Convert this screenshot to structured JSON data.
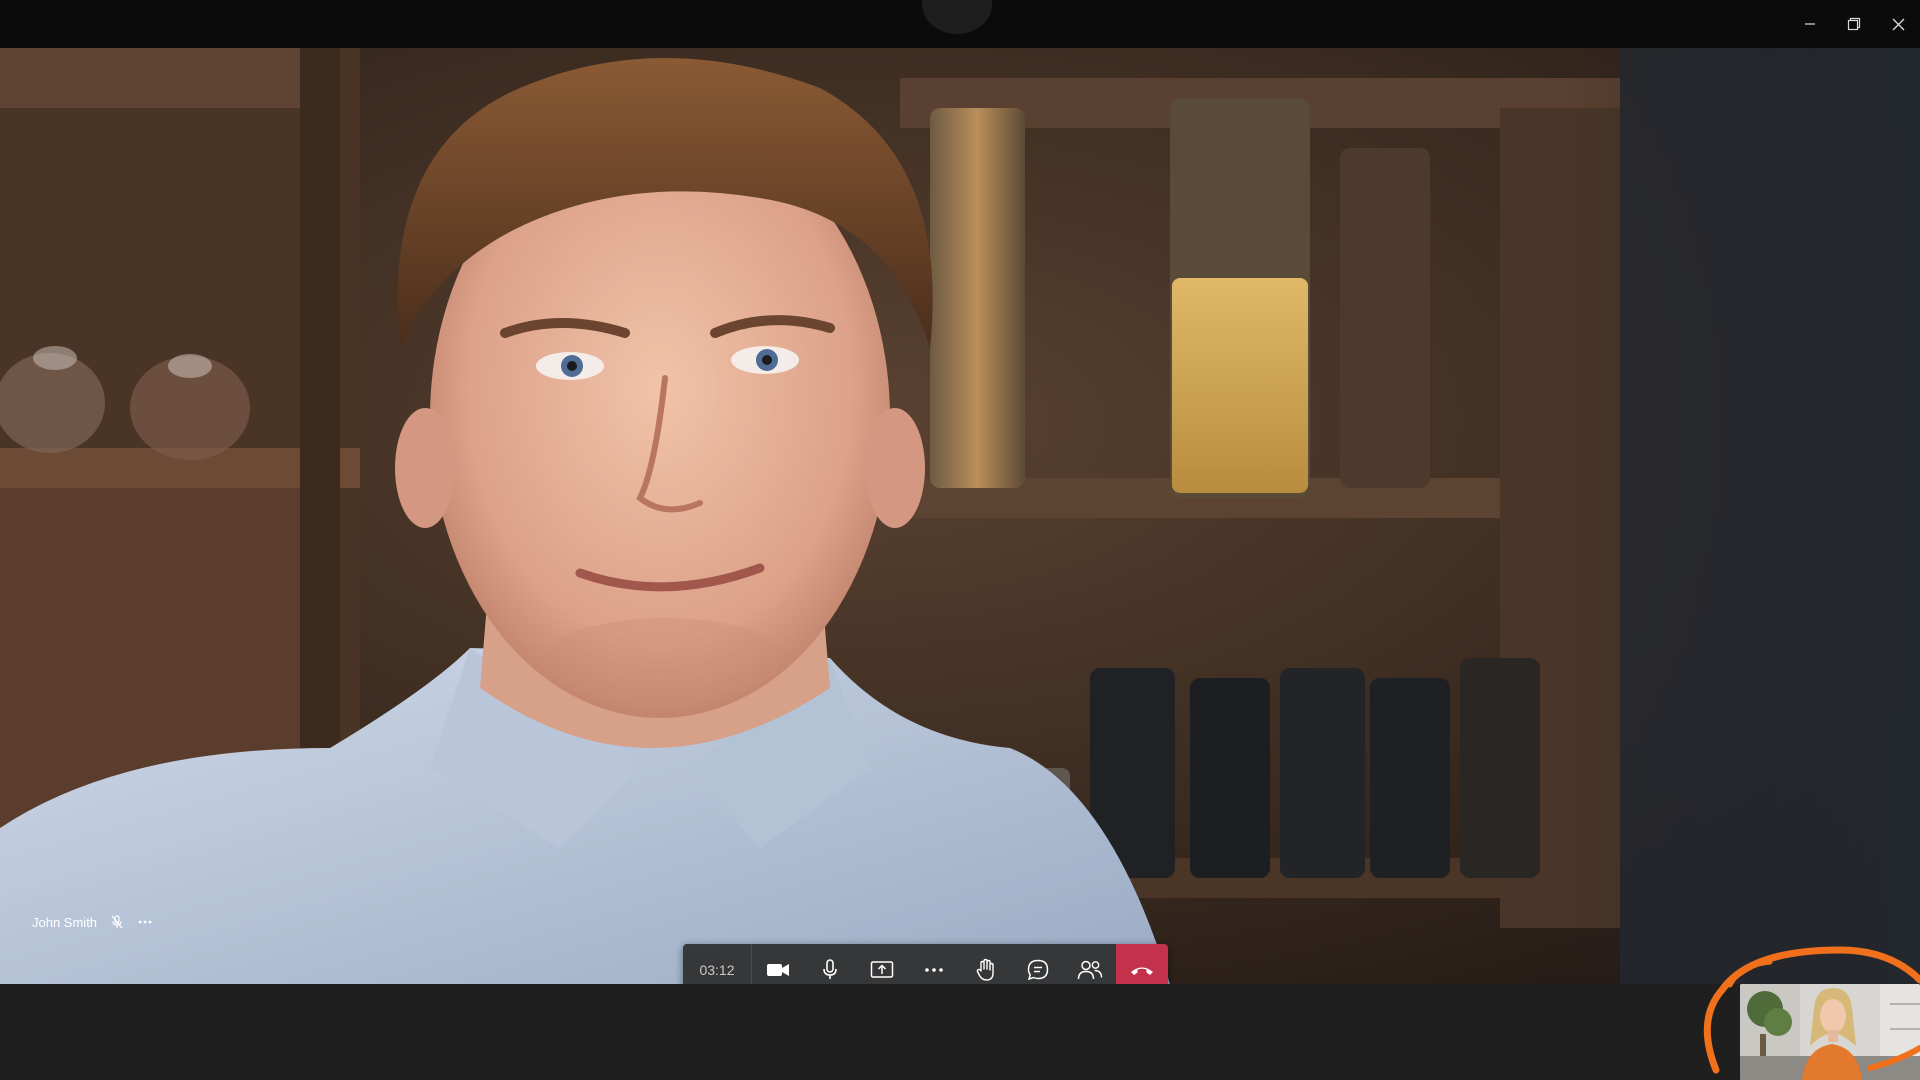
{
  "window": {
    "controls": [
      "minimize",
      "restore",
      "close"
    ]
  },
  "participant": {
    "name": "John Smith",
    "status_icon": "mic-off-icon"
  },
  "call": {
    "timer": "03:12",
    "controls": [
      {
        "name": "camera",
        "icon": "video-camera-icon"
      },
      {
        "name": "mic",
        "icon": "microphone-icon"
      },
      {
        "name": "share",
        "icon": "share-screen-icon"
      },
      {
        "name": "more",
        "icon": "more-actions-icon"
      },
      {
        "name": "raise-hand",
        "icon": "raise-hand-icon"
      },
      {
        "name": "chat",
        "icon": "chat-icon"
      },
      {
        "name": "participants",
        "icon": "people-icon"
      }
    ],
    "hangup_icon": "hang-up-icon"
  },
  "colors": {
    "hangup": "#c4314b",
    "annotation": "#f0701c",
    "bar": "#2d2d2d"
  }
}
